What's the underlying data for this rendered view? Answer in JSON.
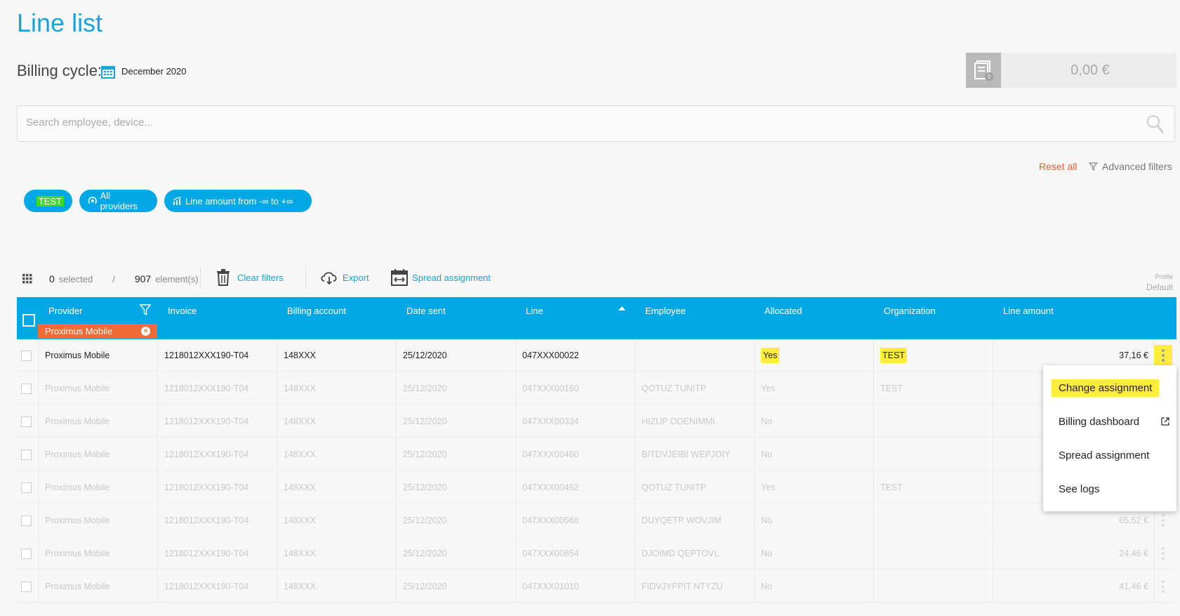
{
  "page": {
    "title": "Line list"
  },
  "billing": {
    "label": "Billing cycle:",
    "value": "December 2020"
  },
  "total": {
    "badge": "0",
    "amount": "0,00 €"
  },
  "search": {
    "placeholder": "Search employee, device..."
  },
  "filters": {
    "reset_all": "Reset all",
    "advanced": "Advanced filters",
    "chips": [
      {
        "label": "TEST"
      },
      {
        "label": "All providers"
      },
      {
        "label": "Line amount from -∞ to +∞"
      }
    ]
  },
  "toolbar": {
    "selected_count": "0",
    "selected_label": "selected",
    "separator": "/",
    "element_count": "907",
    "element_label": "element(s)",
    "clear_filters": "Clear filters",
    "export": "Export",
    "spread_assignment": "Spread assignment",
    "profile_label": "Profile",
    "profile_value": "Default"
  },
  "table": {
    "columns": [
      "Provider",
      "Invoice",
      "Billing account",
      "Date sent",
      "Line",
      "Employee",
      "Allocated",
      "Organization",
      "Line amount"
    ],
    "provider_filter_chip": "Proximus Mobile",
    "rows": [
      {
        "provider": "Proximus Mobile",
        "invoice": "1218012XXX190-T04",
        "account": "148XXX",
        "date": "25/12/2020",
        "line": "047XXX00022",
        "employee": "",
        "allocated": "Yes",
        "organization": "TEST",
        "amount": "37,16 €"
      },
      {
        "provider": "Proximus Mobile",
        "invoice": "1218012XXX190-T04",
        "account": "148XXX",
        "date": "25/12/2020",
        "line": "047XXX00160",
        "employee": "QOTUZ TUNITP",
        "allocated": "Yes",
        "organization": "TEST",
        "amount": ""
      },
      {
        "provider": "Proximus Mobile",
        "invoice": "1218012XXX190-T04",
        "account": "148XXX",
        "date": "25/12/2020",
        "line": "047XXX00334",
        "employee": "HIZUP ODENIMMI",
        "allocated": "No",
        "organization": "",
        "amount": ""
      },
      {
        "provider": "Proximus Mobile",
        "invoice": "1218012XXX190-T04",
        "account": "148XXX",
        "date": "25/12/2020",
        "line": "047XXX00460",
        "employee": "BITDVJEIBI WEPJOIY",
        "allocated": "No",
        "organization": "",
        "amount": ""
      },
      {
        "provider": "Proximus Mobile",
        "invoice": "1218012XXX190-T04",
        "account": "148XXX",
        "date": "25/12/2020",
        "line": "047XXX00462",
        "employee": "QOTUZ TUNITP",
        "allocated": "Yes",
        "organization": "TEST",
        "amount": ""
      },
      {
        "provider": "Proximus Mobile",
        "invoice": "1218012XXX190-T04",
        "account": "148XXX",
        "date": "25/12/2020",
        "line": "047XXX00568",
        "employee": "DUYQETP WOVJIM",
        "allocated": "No",
        "organization": "",
        "amount": "65,52 €"
      },
      {
        "provider": "Proximus Mobile",
        "invoice": "1218012XXX190-T04",
        "account": "148XXX",
        "date": "25/12/2020",
        "line": "047XXX00854",
        "employee": "DJOIMD QEPTOVL",
        "allocated": "No",
        "organization": "",
        "amount": "24,46 €"
      },
      {
        "provider": "Proximus Mobile",
        "invoice": "1218012XXX190-T04",
        "account": "148XXX",
        "date": "25/12/2020",
        "line": "047XXX01010",
        "employee": "FIDVJYPPIT NTYZU",
        "allocated": "No",
        "organization": "",
        "amount": "41,46 €"
      }
    ]
  },
  "context_menu": {
    "items": [
      "Change assignment",
      "Billing dashboard",
      "Spread assignment",
      "See logs"
    ]
  },
  "colors": {
    "accent": "#00a8e6",
    "orange": "#f26b36",
    "highlight": "#ffec3d"
  }
}
